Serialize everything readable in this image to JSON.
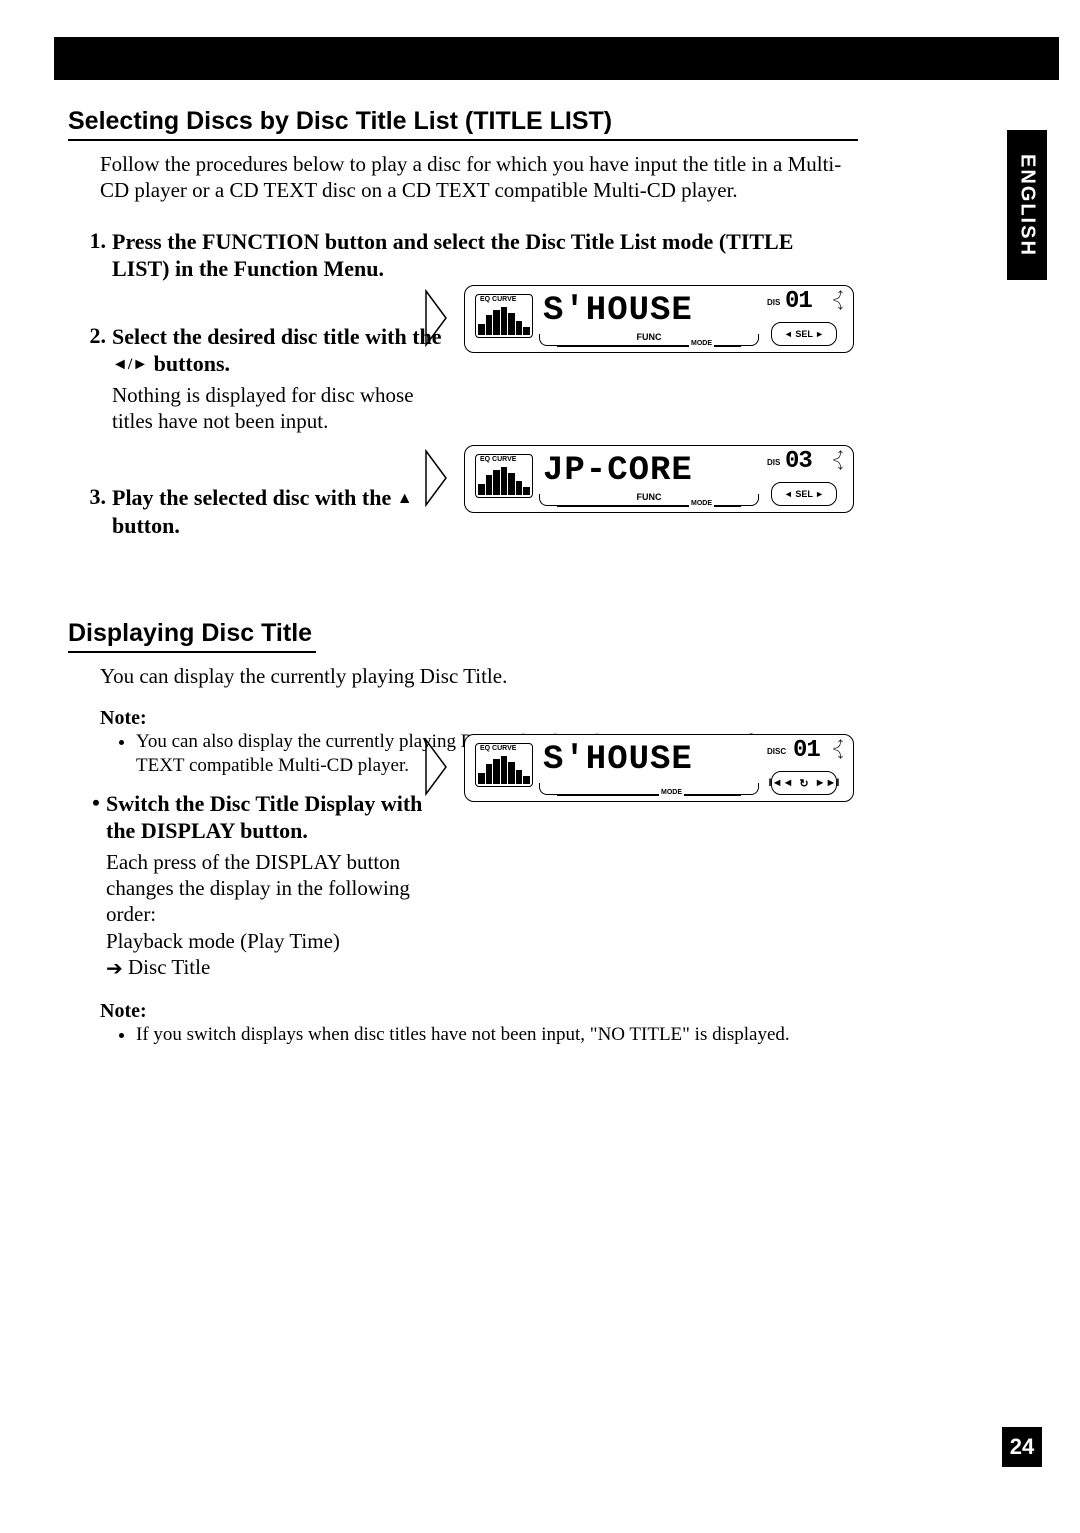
{
  "language_tab": "ENGLISH",
  "page_number": "24",
  "section1": {
    "title": "Selecting Discs by Disc Title List (TITLE LIST)",
    "intro": "Follow the procedures below to play a disc for which you have input the title in a Multi-CD player or a CD TEXT disc on a CD TEXT compatible Multi-CD player.",
    "step1": {
      "num": "1.",
      "title": "Press the FUNCTION button and select the Disc Title List mode (TITLE LIST) in the Function Menu."
    },
    "step2": {
      "num": "2.",
      "title_pre": "Select the desired disc title with the ",
      "title_post": " buttons.",
      "desc": "Nothing is displayed for disc whose titles have not been input."
    },
    "step3": {
      "num": "3.",
      "title_pre": "Play the selected disc with the ",
      "title_post": " button."
    }
  },
  "section2": {
    "title": "Displaying Disc Title",
    "intro": "You can display the currently playing Disc Title.",
    "note1_label": "Note:",
    "note1_item": "You can also display the currently playing Disc Title when playing a CD TEXT disc on a CD TEXT compatible Multi-CD player.",
    "bullet": {
      "title": "Switch the Disc Title Display with the DISPLAY button.",
      "desc1": "Each press of the DISPLAY button changes the display in the following order:",
      "desc2": "Playback mode (Play Time)",
      "desc3": " Disc Title"
    },
    "note2_label": "Note:",
    "note2_item": "If you switch displays when disc titles have not been input, \"NO TITLE\" is displayed."
  },
  "lcd": {
    "eq_label": "EQ CURVE",
    "func": "FUNC",
    "mode": "MODE",
    "disc_short": "DIS",
    "disc_full": "DISC",
    "sel": "◄ SEL ►",
    "panel1": {
      "text": "S'HOUSE",
      "disc": "01"
    },
    "panel2": {
      "text": "JP-CORE",
      "disc": "03"
    },
    "panel3": {
      "text": "S'HOUSE",
      "disc": "01"
    }
  }
}
